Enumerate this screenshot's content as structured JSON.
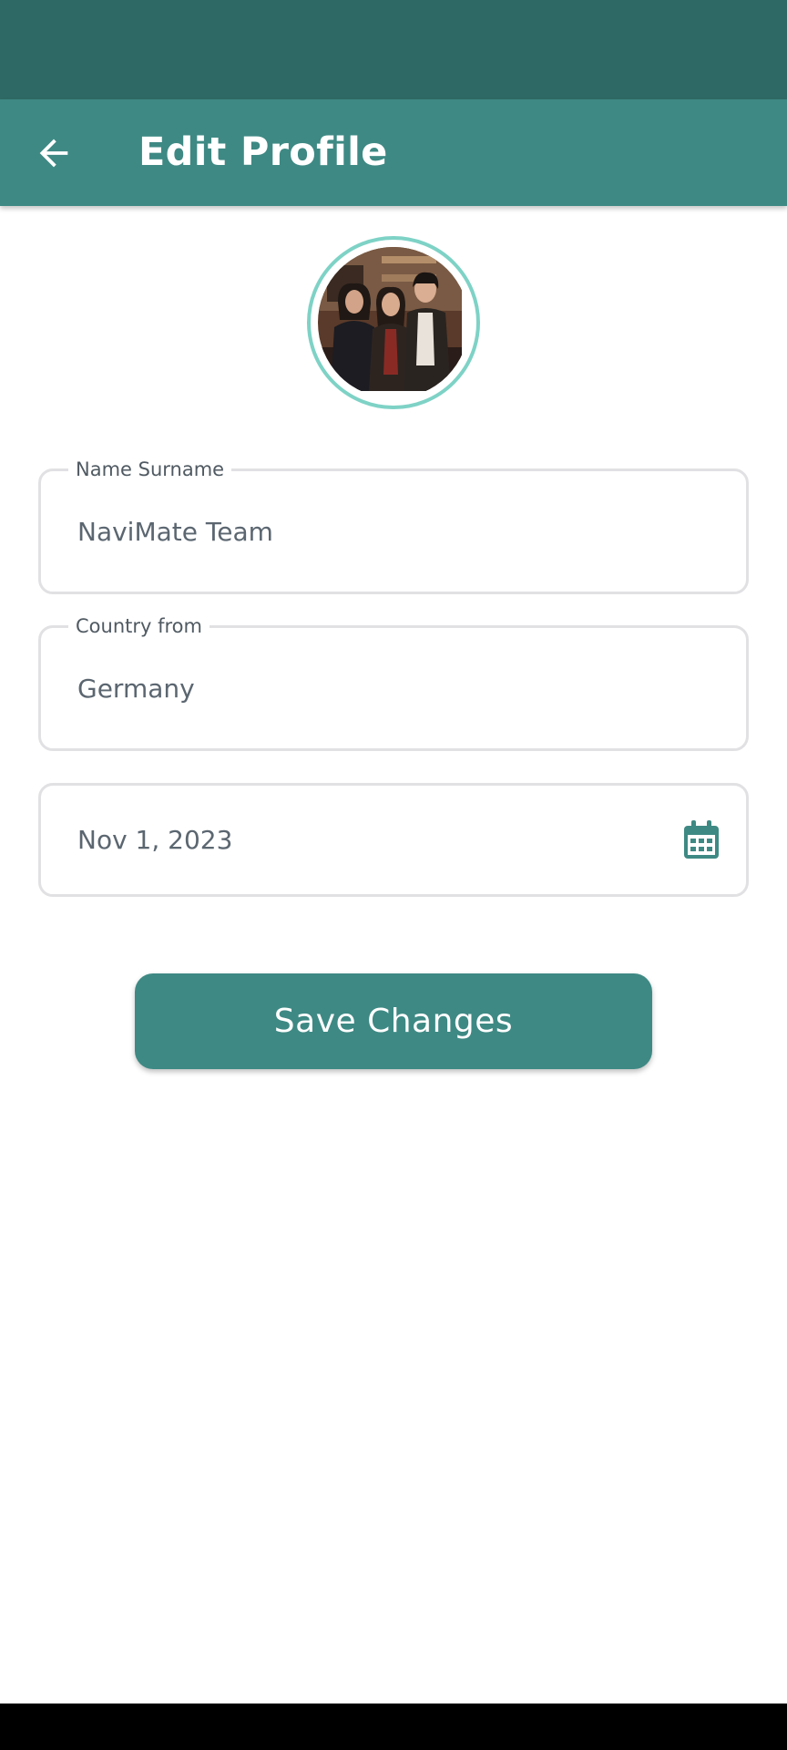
{
  "app_bar": {
    "title": "Edit Profile",
    "back_icon": "arrow-left-icon",
    "background": "#3e8984"
  },
  "status_bar": {
    "background": "#2f6965"
  },
  "profile": {
    "avatar_icon": "profile-photo",
    "ring_color": "#7ed2c6"
  },
  "form": {
    "name": {
      "label": "Name Surname",
      "value": "NaviMate Team"
    },
    "country": {
      "label": "Country from",
      "value": "Germany"
    },
    "date": {
      "value": "Nov 1, 2023",
      "icon": "calendar-icon"
    }
  },
  "save_button": {
    "label": "Save Changes"
  },
  "colors": {
    "accent": "#3e8984",
    "field_border": "#e1e1e4",
    "text": "#5b6670"
  }
}
